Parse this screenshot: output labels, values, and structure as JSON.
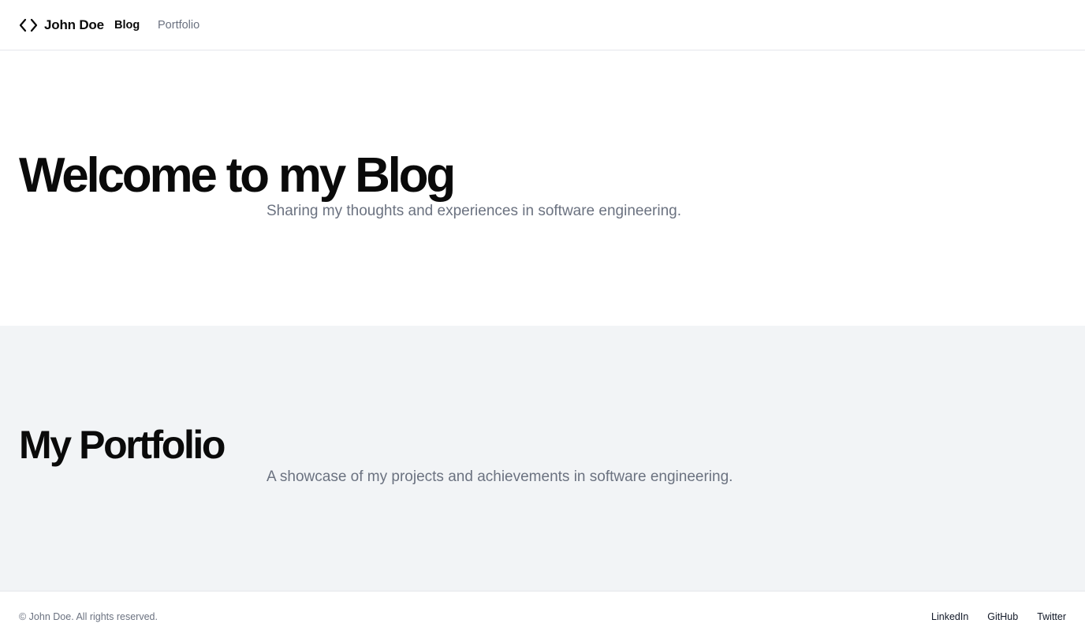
{
  "header": {
    "brand_name": "John Doe",
    "brand_icon": "code-brackets-icon",
    "nav": {
      "blog": "Blog",
      "portfolio": "Portfolio"
    }
  },
  "hero": {
    "title": "Welcome to my Blog",
    "subtitle": "Sharing my thoughts and experiences in software engineering."
  },
  "portfolio": {
    "title": "My Portfolio",
    "subtitle": "A showcase of my projects and achievements in software engineering."
  },
  "footer": {
    "copyright": "© John Doe. All rights reserved.",
    "links": [
      "LinkedIn",
      "GitHub",
      "Twitter"
    ]
  },
  "colors": {
    "text": "#0a0a0a",
    "muted": "#6b7280",
    "section_bg": "#f2f4f6",
    "border": "#e5e7eb"
  }
}
